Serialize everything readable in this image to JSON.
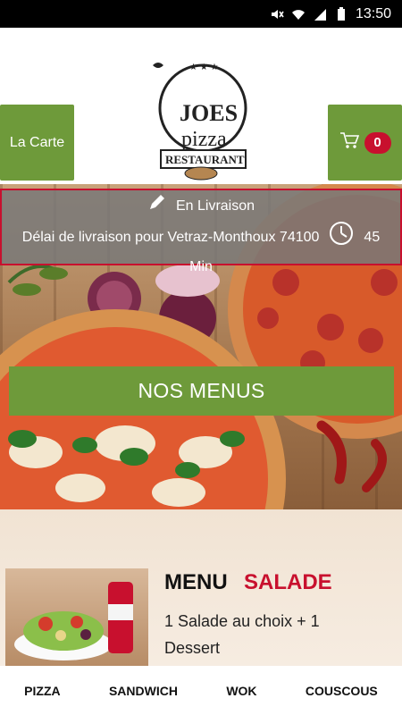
{
  "status_bar": {
    "time": "13:50"
  },
  "header": {
    "left_button": "La Carte",
    "cart_count": "0",
    "logo": {
      "line1": "JOES",
      "line2": "pizza",
      "line3": "RESTAURANT"
    }
  },
  "delivery": {
    "mode": "En Livraison",
    "text": "Délai de livraison pour Vetraz-Monthoux 74100",
    "time": "45",
    "unit": "Min"
  },
  "menus_button": "NOS MENUS",
  "menu_card": {
    "title": "MENU",
    "title_accent": "SALADE",
    "description": "1 Salade au choix + 1 Dessert"
  },
  "bottom_nav": {
    "items": [
      "PIZZA",
      "SANDWICH",
      "WOK",
      "COUSCOUS"
    ]
  },
  "colors": {
    "brand_green": "#6e9a3a",
    "accent_red": "#c8102e"
  },
  "icons": [
    "mute-icon",
    "wifi-icon",
    "signal-icon",
    "battery-icon",
    "cart-icon",
    "pencil-icon",
    "clock-icon"
  ]
}
